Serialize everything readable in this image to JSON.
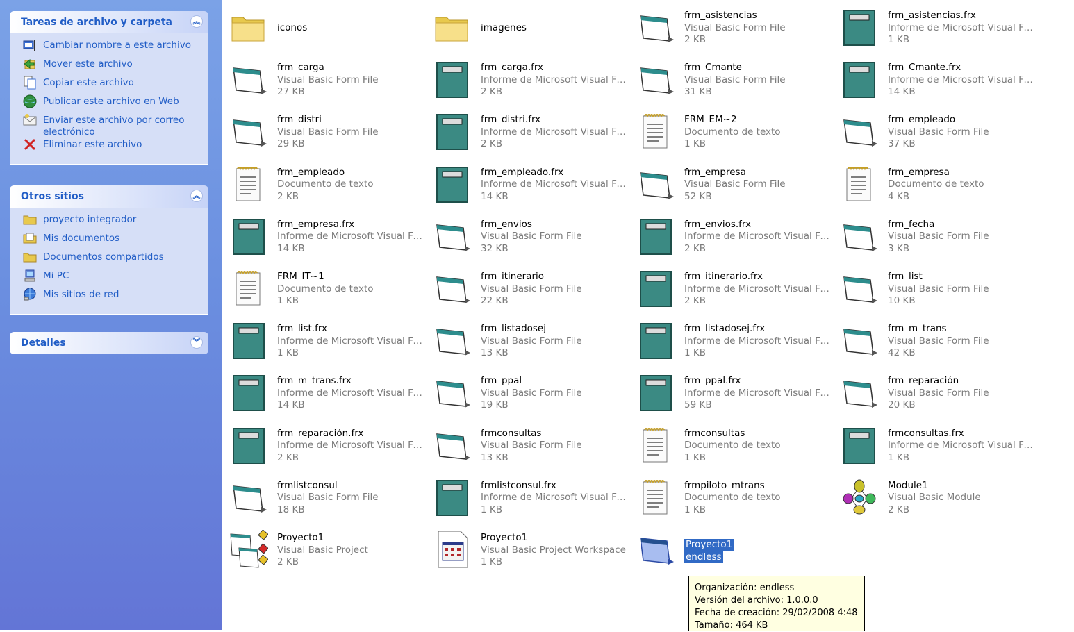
{
  "left_pane": {
    "tasks_panel": {
      "title": "Tareas de archivo y carpeta",
      "items": [
        {
          "label": "Cambiar nombre a este archivo",
          "icon": "rename-icon"
        },
        {
          "label": "Mover este archivo",
          "icon": "move-icon"
        },
        {
          "label": "Copiar este archivo",
          "icon": "copy-icon"
        },
        {
          "label": "Publicar este archivo en Web",
          "icon": "web-publish-icon"
        },
        {
          "label": "Enviar este archivo por correo electrónico",
          "icon": "email-icon"
        },
        {
          "label": "Eliminar este archivo",
          "icon": "delete-icon"
        }
      ]
    },
    "other_places_panel": {
      "title": "Otros sitios",
      "items": [
        {
          "label": "proyecto integrador",
          "icon": "folder-icon"
        },
        {
          "label": "Mis documentos",
          "icon": "my-documents-icon"
        },
        {
          "label": "Documentos compartidos",
          "icon": "folder-icon"
        },
        {
          "label": "Mi PC",
          "icon": "my-computer-icon"
        },
        {
          "label": "Mis sitios de red",
          "icon": "network-icon"
        }
      ]
    },
    "details_panel": {
      "title": "Detalles"
    }
  },
  "files": [
    {
      "name": "iconos",
      "type": "",
      "size": "",
      "icon": "folder"
    },
    {
      "name": "imagenes",
      "type": "",
      "size": "",
      "icon": "folder"
    },
    {
      "name": "frm_asistencias",
      "type": "Visual Basic Form File",
      "size": "2 KB",
      "icon": "form"
    },
    {
      "name": "frm_asistencias.frx",
      "type": "Informe de Microsoft Visual Fo...",
      "size": "1 KB",
      "icon": "frx"
    },
    {
      "name": "frm_carga",
      "type": "Visual Basic Form File",
      "size": "27 KB",
      "icon": "form"
    },
    {
      "name": "frm_carga.frx",
      "type": "Informe de Microsoft Visual Fo...",
      "size": "2 KB",
      "icon": "frx"
    },
    {
      "name": "frm_Cmante",
      "type": "Visual Basic Form File",
      "size": "31 KB",
      "icon": "form"
    },
    {
      "name": "frm_Cmante.frx",
      "type": "Informe de Microsoft Visual Fo...",
      "size": "14 KB",
      "icon": "frx"
    },
    {
      "name": "frm_distri",
      "type": "Visual Basic Form File",
      "size": "29 KB",
      "icon": "form"
    },
    {
      "name": "frm_distri.frx",
      "type": "Informe de Microsoft Visual Fo...",
      "size": "2 KB",
      "icon": "frx"
    },
    {
      "name": "FRM_EM~2",
      "type": "Documento de texto",
      "size": "1 KB",
      "icon": "text"
    },
    {
      "name": "frm_empleado",
      "type": "Visual Basic Form File",
      "size": "37 KB",
      "icon": "form"
    },
    {
      "name": "frm_empleado",
      "type": "Documento de texto",
      "size": "2 KB",
      "icon": "text"
    },
    {
      "name": "frm_empleado.frx",
      "type": "Informe de Microsoft Visual Fo...",
      "size": "14 KB",
      "icon": "frx"
    },
    {
      "name": "frm_empresa",
      "type": "Visual Basic Form File",
      "size": "52 KB",
      "icon": "form"
    },
    {
      "name": "frm_empresa",
      "type": "Documento de texto",
      "size": "4 KB",
      "icon": "text"
    },
    {
      "name": "frm_empresa.frx",
      "type": "Informe de Microsoft Visual Fo...",
      "size": "14 KB",
      "icon": "frx"
    },
    {
      "name": "frm_envios",
      "type": "Visual Basic Form File",
      "size": "32 KB",
      "icon": "form"
    },
    {
      "name": "frm_envios.frx",
      "type": "Informe de Microsoft Visual Fo...",
      "size": "2 KB",
      "icon": "frx"
    },
    {
      "name": "frm_fecha",
      "type": "Visual Basic Form File",
      "size": "3 KB",
      "icon": "form"
    },
    {
      "name": "FRM_IT~1",
      "type": "Documento de texto",
      "size": "1 KB",
      "icon": "text"
    },
    {
      "name": "frm_itinerario",
      "type": "Visual Basic Form File",
      "size": "22 KB",
      "icon": "form"
    },
    {
      "name": "frm_itinerario.frx",
      "type": "Informe de Microsoft Visual Fo...",
      "size": "2 KB",
      "icon": "frx"
    },
    {
      "name": "frm_list",
      "type": "Visual Basic Form File",
      "size": "10 KB",
      "icon": "form"
    },
    {
      "name": "frm_list.frx",
      "type": "Informe de Microsoft Visual Fo...",
      "size": "1 KB",
      "icon": "frx"
    },
    {
      "name": "frm_listadosej",
      "type": "Visual Basic Form File",
      "size": "13 KB",
      "icon": "form"
    },
    {
      "name": "frm_listadosej.frx",
      "type": "Informe de Microsoft Visual Fo...",
      "size": "1 KB",
      "icon": "frx"
    },
    {
      "name": "frm_m_trans",
      "type": "Visual Basic Form File",
      "size": "42 KB",
      "icon": "form"
    },
    {
      "name": "frm_m_trans.frx",
      "type": "Informe de Microsoft Visual Fo...",
      "size": "14 KB",
      "icon": "frx"
    },
    {
      "name": "frm_ppal",
      "type": "Visual Basic Form File",
      "size": "19 KB",
      "icon": "form"
    },
    {
      "name": "frm_ppal.frx",
      "type": "Informe de Microsoft Visual Fo...",
      "size": "59 KB",
      "icon": "frx"
    },
    {
      "name": "frm_reparación",
      "type": "Visual Basic Form File",
      "size": "20 KB",
      "icon": "form"
    },
    {
      "name": "frm_reparación.frx",
      "type": "Informe de Microsoft Visual Fo...",
      "size": "2 KB",
      "icon": "frx"
    },
    {
      "name": "frmconsultas",
      "type": "Visual Basic Form File",
      "size": "13 KB",
      "icon": "form"
    },
    {
      "name": "frmconsultas",
      "type": "Documento de texto",
      "size": "1 KB",
      "icon": "text"
    },
    {
      "name": "frmconsultas.frx",
      "type": "Informe de Microsoft Visual Fo...",
      "size": "1 KB",
      "icon": "frx"
    },
    {
      "name": "frmlistconsul",
      "type": "Visual Basic Form File",
      "size": "18 KB",
      "icon": "form"
    },
    {
      "name": "frmlistconsul.frx",
      "type": "Informe de Microsoft Visual Fo...",
      "size": "1 KB",
      "icon": "frx"
    },
    {
      "name": "frmpiloto_mtrans",
      "type": "Documento de texto",
      "size": "1 KB",
      "icon": "text"
    },
    {
      "name": "Module1",
      "type": "Visual Basic Module",
      "size": "2 KB",
      "icon": "module"
    },
    {
      "name": "Proyecto1",
      "type": "Visual Basic Project",
      "size": "2 KB",
      "icon": "vbproject"
    },
    {
      "name": "Proyecto1",
      "type": "Visual Basic Project Workspace",
      "size": "1 KB",
      "icon": "workspace"
    },
    {
      "name": "Proyecto1",
      "type": "endless",
      "size": "",
      "icon": "selected-form",
      "selected": true
    }
  ],
  "tooltip": {
    "lines": [
      "Organización: endless",
      "Versión del archivo: 1.0.0.0",
      "Fecha de creación: 29/02/2008 4:48",
      "Tamaño: 464 KB"
    ]
  }
}
